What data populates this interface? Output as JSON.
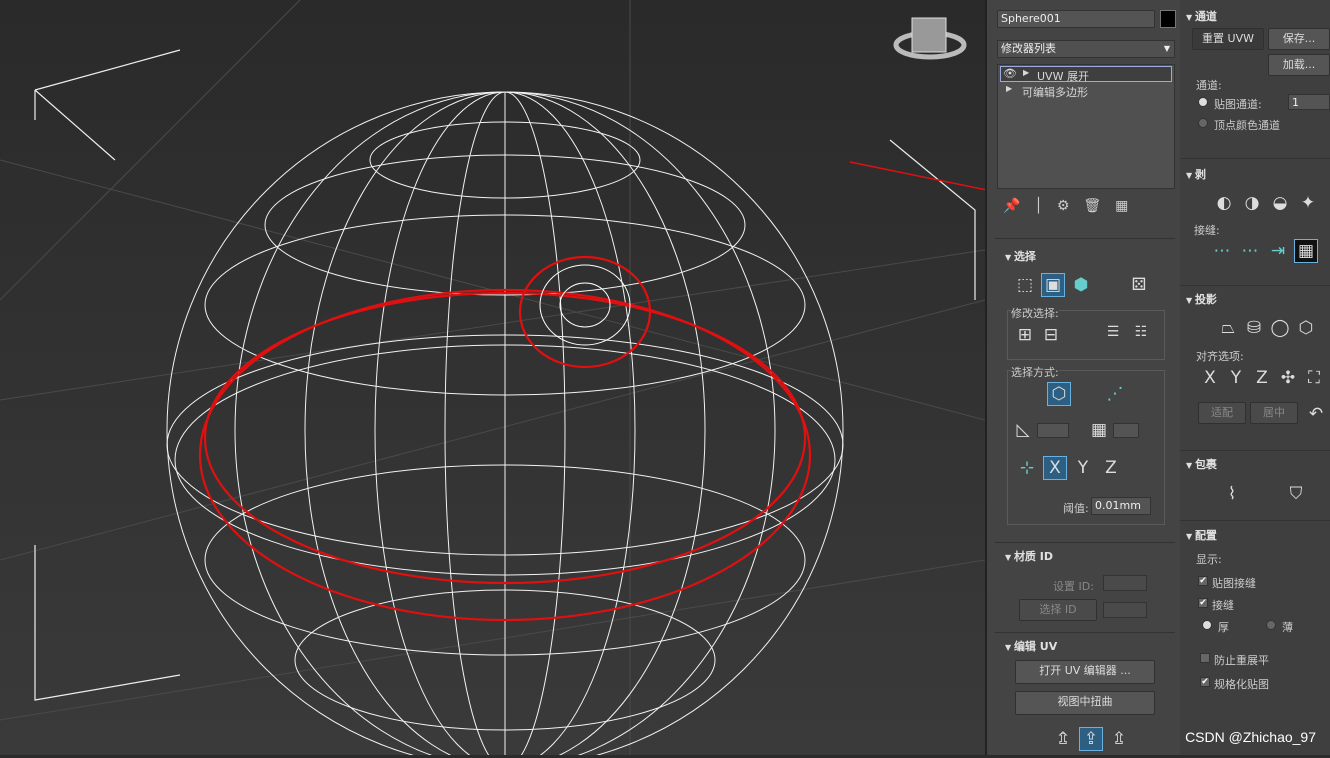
{
  "object_name": "Sphere001",
  "object_color": "#000000",
  "modifier_list": "修改器列表",
  "stack": [
    "UVW 展开",
    "可编辑多边形"
  ],
  "select": {
    "title": "选择",
    "modify_selection": "修改选择:",
    "select_by": "选择方式:",
    "threshold_label": "阈值:",
    "threshold_value": "0.01mm",
    "axes": [
      "X",
      "Y",
      "Z"
    ]
  },
  "material_id": {
    "title": "材质 ID",
    "set_id": "设置 ID:",
    "select_id": "选择 ID"
  },
  "edit_uv": {
    "title": "编辑 UV",
    "open_editor": "打开 UV 编辑器 ...",
    "tweak": "视图中扭曲"
  },
  "channel": {
    "title": "通道",
    "reset": "重置 UVW",
    "save": "保存...",
    "load": "加载...",
    "channel_label": "通道:",
    "map_channel": "贴图通道:",
    "map_channel_value": "1",
    "vertex_color": "顶点颜色通道"
  },
  "peel": {
    "title": "剥",
    "seams": "接缝:"
  },
  "projection": {
    "title": "投影",
    "align": "对齐选项:",
    "axes": [
      "X",
      "Y",
      "Z"
    ],
    "fit": "适配",
    "center": "居中"
  },
  "wrap": {
    "title": "包裹"
  },
  "config": {
    "title": "配置",
    "display": "显示:",
    "map_seams": "贴图接缝",
    "seams": "接缝",
    "thick": "厚",
    "thin": "薄",
    "prevent_flatten": "防止重展平",
    "normalize": "规格化贴图"
  },
  "watermark": "CSDN @Zhichao_97"
}
